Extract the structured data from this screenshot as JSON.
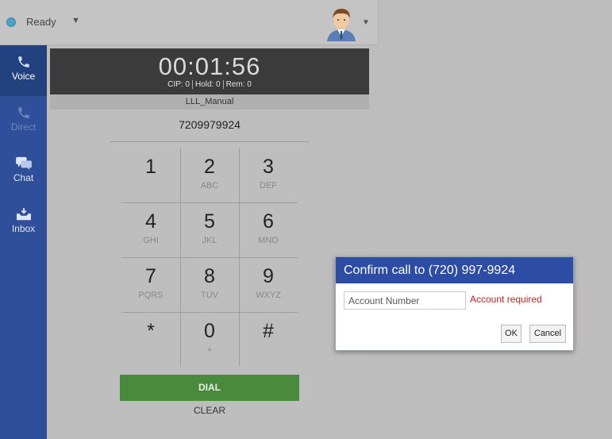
{
  "topbar": {
    "status_label": "Ready",
    "status_color": "#4aa3c7",
    "status_caret_icon": "chevron-down-icon",
    "avatar_icon": "user-avatar-icon",
    "avatar_caret_icon": "chevron-down-icon"
  },
  "nav": {
    "items": [
      {
        "label": "Voice",
        "icon": "phone-icon",
        "state": "active"
      },
      {
        "label": "Direct",
        "icon": "phone-icon",
        "state": "disabled"
      },
      {
        "label": "Chat",
        "icon": "chat-icon",
        "state": "normal"
      },
      {
        "label": "Inbox",
        "icon": "inbox-icon",
        "state": "normal"
      }
    ],
    "background_color": "#2f4f9a"
  },
  "call": {
    "timer": "00:01:56",
    "cip": "CIP: 0",
    "hold": "Hold: 0",
    "rem": "Rem: 0",
    "campaign": "LLL_Manual",
    "number": "7209979924"
  },
  "keypad": {
    "keys": [
      {
        "digit": "1",
        "letters": ""
      },
      {
        "digit": "2",
        "letters": "ABC"
      },
      {
        "digit": "3",
        "letters": "DEF"
      },
      {
        "digit": "4",
        "letters": "GHI"
      },
      {
        "digit": "5",
        "letters": "JKL"
      },
      {
        "digit": "6",
        "letters": "MNO"
      },
      {
        "digit": "7",
        "letters": "PQRS"
      },
      {
        "digit": "8",
        "letters": "TUV"
      },
      {
        "digit": "9",
        "letters": "WXYZ"
      },
      {
        "digit": "*",
        "letters": ""
      },
      {
        "digit": "0",
        "letters": "+"
      },
      {
        "digit": "#",
        "letters": ""
      }
    ],
    "dial_label": "DIAL",
    "dial_color": "#4a8a3c",
    "clear_label": "CLEAR"
  },
  "modal": {
    "title": "Confirm call to (720) 997-9924",
    "title_bg": "#2c4da3",
    "input_placeholder": "Account Number",
    "input_value": "",
    "error_text": "Account required",
    "error_color": "#cc2222",
    "ok_label": "OK",
    "cancel_label": "Cancel"
  }
}
